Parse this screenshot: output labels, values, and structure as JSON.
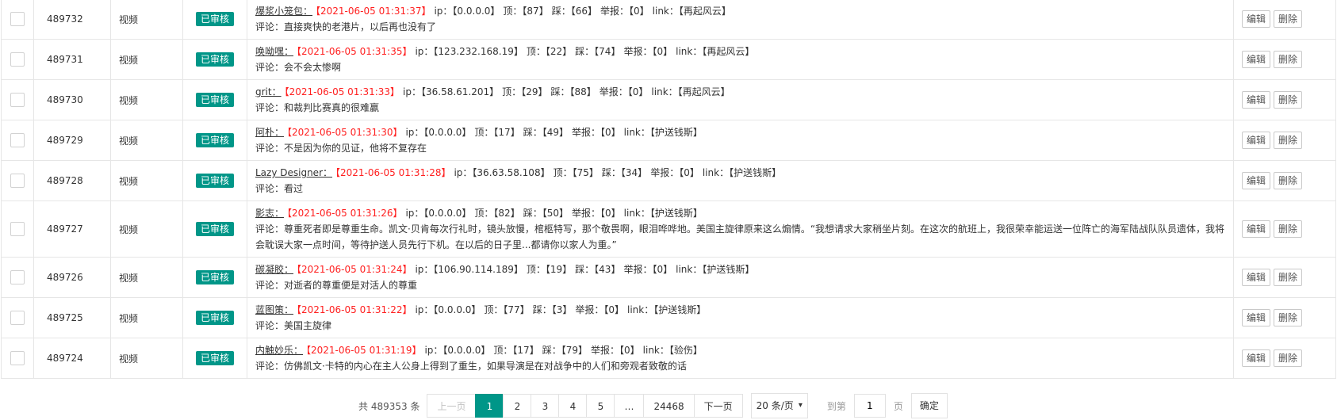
{
  "colors": {
    "accent": "#009688",
    "time": "#ff2020",
    "border": "#e6e6e6"
  },
  "labels": {
    "ip": "ip：",
    "up": "顶：",
    "down": "踩：",
    "report": "举报：",
    "link": "link：",
    "comment_prefix": "评论："
  },
  "rows": [
    {
      "id": "489732",
      "type": "视频",
      "status": "已审核",
      "user": "爆浆小笼包：",
      "time": "【2021-06-05 01:31:37】",
      "ip": "【0.0.0.0】",
      "up": "【87】",
      "down": "【66】",
      "report": "【0】",
      "link": "【再起风云】",
      "comment": "直接爽快的老港片，以后再也没有了",
      "edit": "编辑",
      "delete": "删除"
    },
    {
      "id": "489731",
      "type": "视频",
      "status": "已审核",
      "user": "唤呦嘿：",
      "time": "【2021-06-05 01:31:35】",
      "ip": "【123.232.168.19】",
      "up": "【22】",
      "down": "【74】",
      "report": "【0】",
      "link": "【再起风云】",
      "comment": "会不会太惨啊",
      "edit": "编辑",
      "delete": "删除"
    },
    {
      "id": "489730",
      "type": "视频",
      "status": "已审核",
      "user": "grit：",
      "time": "【2021-06-05 01:31:33】",
      "ip": "【36.58.61.201】",
      "up": "【29】",
      "down": "【88】",
      "report": "【0】",
      "link": "【再起风云】",
      "comment": "和裁判比赛真的很难赢",
      "edit": "编辑",
      "delete": "删除"
    },
    {
      "id": "489729",
      "type": "视频",
      "status": "已审核",
      "user": "阿朴：",
      "time": "【2021-06-05 01:31:30】",
      "ip": "【0.0.0.0】",
      "up": "【17】",
      "down": "【49】",
      "report": "【0】",
      "link": "【护送钱斯】",
      "comment": "不是因为你的见证，他将不复存在",
      "edit": "编辑",
      "delete": "删除"
    },
    {
      "id": "489728",
      "type": "视频",
      "status": "已审核",
      "user": "Lazy Designer：",
      "time": "【2021-06-05 01:31:28】",
      "ip": "【36.63.58.108】",
      "up": "【75】",
      "down": "【34】",
      "report": "【0】",
      "link": "【护送钱斯】",
      "comment": "看过",
      "edit": "编辑",
      "delete": "删除"
    },
    {
      "id": "489727",
      "type": "视频",
      "status": "已审核",
      "user": "影志：",
      "time": "【2021-06-05 01:31:26】",
      "ip": "【0.0.0.0】",
      "up": "【82】",
      "down": "【50】",
      "report": "【0】",
      "link": "【护送钱斯】",
      "comment": "尊重死者即是尊重生命。凯文·贝肯每次行礼时，镜头放慢，棺柩特写，那个敬畏啊，眼泪哗哗地。美国主旋律原来这么煽情。“我想请求大家稍坐片刻。在这次的航班上，我很荣幸能运送一位阵亡的海军陆战队队员遗体，我将会耽误大家一点时间，等待护送人员先行下机。在以后的日子里...都请你以家人为重。”",
      "edit": "编辑",
      "delete": "删除",
      "tall": true
    },
    {
      "id": "489726",
      "type": "视频",
      "status": "已审核",
      "user": "碳凝胶：",
      "time": "【2021-06-05 01:31:24】",
      "ip": "【106.90.114.189】",
      "up": "【19】",
      "down": "【43】",
      "report": "【0】",
      "link": "【护送钱斯】",
      "comment": "对逝者的尊重便是对活人的尊重",
      "edit": "编辑",
      "delete": "删除"
    },
    {
      "id": "489725",
      "type": "视频",
      "status": "已审核",
      "user": "蓝图策：",
      "time": "【2021-06-05 01:31:22】",
      "ip": "【0.0.0.0】",
      "up": "【77】",
      "down": "【3】",
      "report": "【0】",
      "link": "【护送钱斯】",
      "comment": "美国主旋律",
      "edit": "编辑",
      "delete": "删除"
    },
    {
      "id": "489724",
      "type": "视频",
      "status": "已审核",
      "user": "内触妙乐：",
      "time": "【2021-06-05 01:31:19】",
      "ip": "【0.0.0.0】",
      "up": "【17】",
      "down": "【79】",
      "report": "【0】",
      "link": "【验伤】",
      "comment": "仿佛凯文·卡特的内心在主人公身上得到了重生，如果导演是在对战争中的人们和旁观者致敬的话",
      "edit": "编辑",
      "delete": "删除"
    }
  ],
  "pagination": {
    "total": "共 489353 条",
    "prev": "上一页",
    "pages": [
      "1",
      "2",
      "3",
      "4",
      "5",
      "…",
      "24468"
    ],
    "current": "1",
    "next": "下一页",
    "page_size": "20 条/页",
    "jump_label": "到第",
    "jump_value": "1",
    "page_unit": "页",
    "go": "确定"
  }
}
